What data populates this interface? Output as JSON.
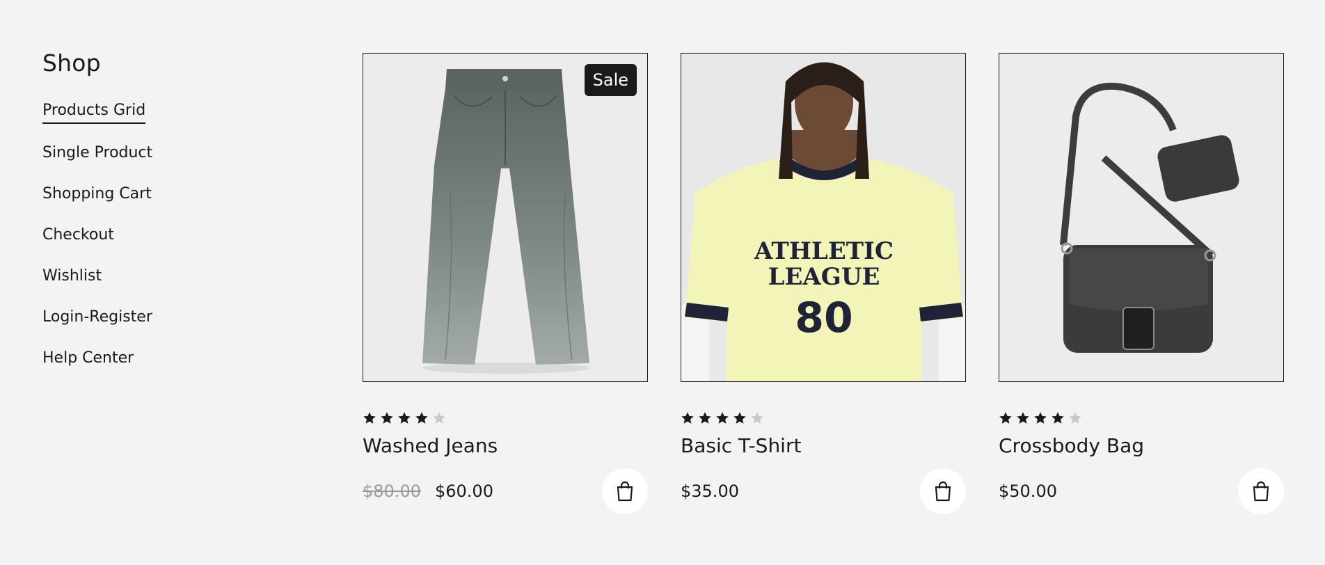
{
  "sidebar": {
    "title": "Shop",
    "items": [
      {
        "label": "Products Grid",
        "active": true
      },
      {
        "label": "Single Product"
      },
      {
        "label": "Shopping Cart"
      },
      {
        "label": "Checkout"
      },
      {
        "label": "Wishlist"
      },
      {
        "label": "Login-Register"
      },
      {
        "label": "Help Center"
      }
    ]
  },
  "products": [
    {
      "name": "Washed Jeans",
      "badge": "Sale",
      "rating": 4,
      "rating_max": 5,
      "old_price": "$80.00",
      "price": "$60.00",
      "image": "jeans"
    },
    {
      "name": "Basic T-Shirt",
      "rating": 4,
      "rating_max": 5,
      "price": "$35.00",
      "image": "t-shirt",
      "shirt_text": [
        "ATHLETIC",
        "LEAGUE",
        "80"
      ]
    },
    {
      "name": "Crossbody Bag",
      "rating": 4,
      "rating_max": 5,
      "price": "$50.00",
      "image": "bag"
    }
  ],
  "colors": {
    "background": "#f3f3f3",
    "text": "#1a1a1a",
    "star_filled": "#1a1a1a",
    "star_empty": "#c9c9c9",
    "old_price": "#9a9a9a",
    "shirt": "#f3f5b8"
  },
  "icons": {
    "cart": "shopping-bag-icon",
    "star": "star-icon"
  }
}
